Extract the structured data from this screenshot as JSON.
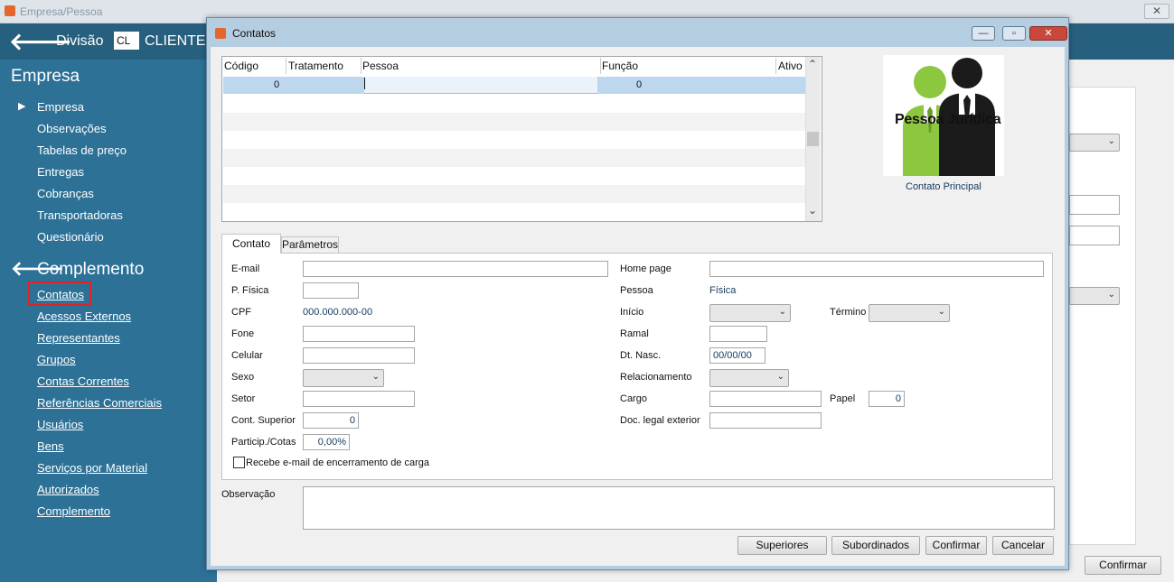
{
  "main_window": {
    "title": "Empresa/Pessoa",
    "close_glyph": "✕"
  },
  "topbar": {
    "back_glyph": "🡐",
    "divisao_label": "Divisão",
    "divisao_code": "CL",
    "divisao_name": "CLIENTE"
  },
  "sidebar": {
    "empresa_heading": "Empresa",
    "current_marker": "▶",
    "empresa_items": [
      "Empresa",
      "Observações",
      "Tabelas de preço",
      "Entregas",
      "Cobranças",
      "Transportadoras",
      "Questionário"
    ],
    "complemento_heading": "Complemento",
    "complemento_back_glyph": "🡐",
    "complemento_items": [
      "Contatos",
      "Acessos Externos",
      "Representantes",
      "Grupos",
      "Contas Correntes",
      "Referências Comerciais",
      "Usuários",
      "Bens",
      "Serviços por Material",
      "Autorizados",
      "Complemento"
    ]
  },
  "main_footer": {
    "confirm_label": "Confirmar"
  },
  "dialog": {
    "title": "Contatos",
    "grid": {
      "columns": [
        "Código",
        "Tratamento",
        "Pessoa",
        "Função",
        "Ativo"
      ],
      "selected_row": {
        "codigo": "0",
        "funcao": "0"
      },
      "scroll_up": "⌃",
      "scroll_down": "⌄"
    },
    "logo": {
      "text": "Pessoa Jurídica",
      "caption": "Contato Principal"
    },
    "tabs": [
      "Contato",
      "Parâmetros"
    ],
    "form": {
      "email_label": "E-mail",
      "pfisica_label": "P. Física",
      "cpf_label": "CPF",
      "cpf_value": "000.000.000-00",
      "fone_label": "Fone",
      "celular_label": "Celular",
      "sexo_label": "Sexo",
      "setor_label": "Setor",
      "cont_superior_label": "Cont. Superior",
      "cont_superior_value": "0",
      "particip_label": "Particip./Cotas",
      "particip_value": "0,00%",
      "recebe_email_label": "Recebe e-mail de encerramento de carga",
      "homepage_label": "Home page",
      "pessoa_label": "Pessoa",
      "pessoa_value": "Física",
      "inicio_label": "Início",
      "termino_label": "Término",
      "ramal_label": "Ramal",
      "dtnasc_label": "Dt. Nasc.",
      "dtnasc_value": "00/00/00",
      "relacionamento_label": "Relacionamento",
      "cargo_label": "Cargo",
      "papel_label": "Papel",
      "papel_value": "0",
      "doc_legal_label": "Doc. legal exterior",
      "observacao_label": "Observação",
      "combo_arrow": "⌄"
    },
    "buttons": [
      "Superiores",
      "Subordinados",
      "Confirmar",
      "Cancelar"
    ]
  }
}
